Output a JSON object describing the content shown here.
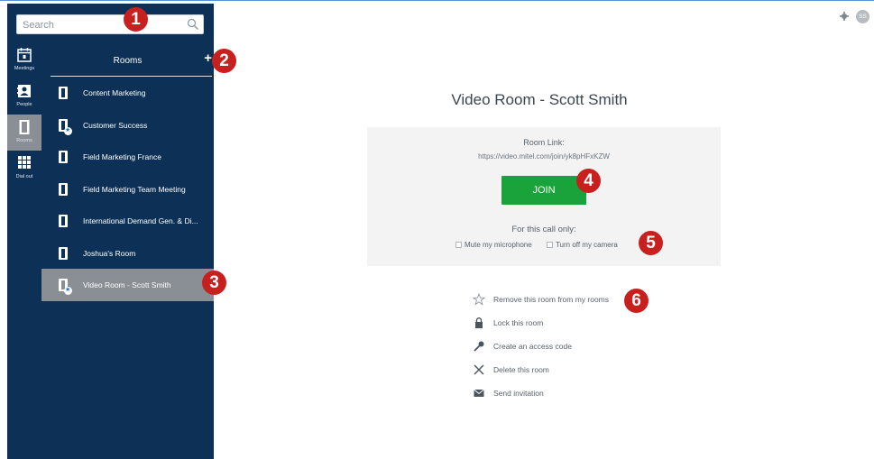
{
  "search": {
    "placeholder": "Search"
  },
  "nav": {
    "items": [
      {
        "label": "Meetings",
        "icon": "calendar-icon",
        "active": false
      },
      {
        "label": "People",
        "icon": "contact-card-icon",
        "active": false
      },
      {
        "label": "Rooms",
        "icon": "door-icon",
        "active": true
      },
      {
        "label": "Dial out",
        "icon": "dialpad-icon",
        "active": false
      }
    ]
  },
  "rooms": {
    "title": "Rooms",
    "add_symbol": "+",
    "items": [
      {
        "label": "Content Marketing",
        "badge": false,
        "selected": false
      },
      {
        "label": "Customer Success",
        "badge": true,
        "selected": false
      },
      {
        "label": "Field Marketing France",
        "badge": false,
        "selected": false
      },
      {
        "label": "Field Marketing Team Meeting",
        "badge": false,
        "selected": false
      },
      {
        "label": "International Demand Gen. & Di...",
        "badge": false,
        "selected": false
      },
      {
        "label": "Joshua's Room",
        "badge": false,
        "selected": false
      },
      {
        "label": "Video Room - Scott Smith",
        "badge": true,
        "selected": true
      }
    ]
  },
  "header": {
    "avatar_initials": "SS",
    "settings_icon": "gear-icon"
  },
  "main": {
    "title": "Video Room - Scott Smith",
    "room_link_label": "Room Link:",
    "room_link_url": "https://video.mitel.com/join/yk8pHFxKZW",
    "join_label": "JOIN",
    "call_only_label": "For this call only:",
    "options": [
      {
        "label": "Mute my microphone",
        "checked": false
      },
      {
        "label": "Turn off my camera",
        "checked": false
      }
    ],
    "actions": [
      {
        "label": "Remove this room from my rooms",
        "icon": "star-icon"
      },
      {
        "label": "Lock this room",
        "icon": "lock-icon"
      },
      {
        "label": "Create an access code",
        "icon": "key-icon"
      },
      {
        "label": "Delete this room",
        "icon": "close-icon"
      },
      {
        "label": "Send invitation",
        "icon": "envelope-icon"
      }
    ]
  },
  "callouts": [
    "1",
    "2",
    "3",
    "4",
    "5",
    "6"
  ],
  "colors": {
    "sidebar": "#0d3156",
    "selected": "#8a8f95",
    "join": "#1aa33a",
    "callout": "#c8201e"
  }
}
